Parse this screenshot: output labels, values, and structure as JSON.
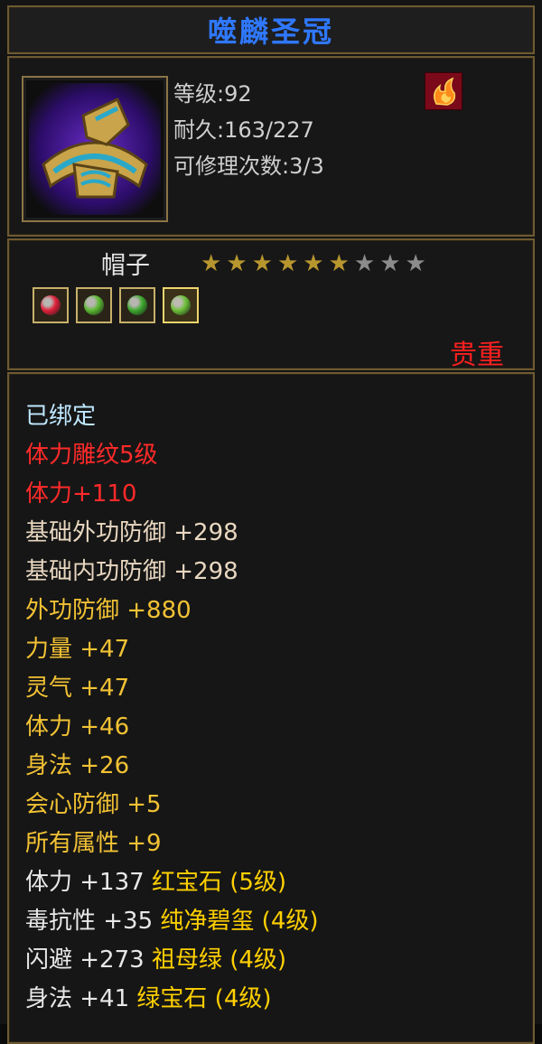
{
  "item": {
    "name": "噬麟圣冠",
    "level_label": "等级",
    "level": "92",
    "durability_label": "耐久",
    "durability": "163/227",
    "repair_label": "可修理次数",
    "repair": "3/3",
    "type": "帽子",
    "stars_filled": 6,
    "stars_total": 9,
    "rarity": "贵重"
  },
  "gems": [
    {
      "icon": "red-gem-icon",
      "color": "#e0203a"
    },
    {
      "icon": "green-gem-icon",
      "color": "#5ab830"
    },
    {
      "icon": "green-gem-icon",
      "color": "#3ea82e"
    },
    {
      "icon": "green-gem-icon",
      "color": "#6cc038"
    }
  ],
  "attributes": [
    {
      "text": "已绑定",
      "style": "bound"
    },
    {
      "text": "体力雕纹5级",
      "style": "red"
    },
    {
      "text": "体力+110",
      "style": "red"
    },
    {
      "text": "基础外功防御 +298",
      "style": "base"
    },
    {
      "text": "基础内功防御 +298",
      "style": "base"
    },
    {
      "text": "外功防御 +880",
      "style": "yellow"
    },
    {
      "text": "力量 +47",
      "style": "yellow"
    },
    {
      "text": "灵气 +47",
      "style": "yellow"
    },
    {
      "text": "体力 +46",
      "style": "yellow"
    },
    {
      "text": "身法 +26",
      "style": "yellow"
    },
    {
      "text": "会心防御 +5",
      "style": "yellow"
    },
    {
      "text": "所有属性 +9",
      "style": "yellow"
    }
  ],
  "gem_attributes": [
    {
      "stat": "体力 +137",
      "gem": "红宝石 (5级)"
    },
    {
      "stat": "毒抗性 +35",
      "gem": "纯净碧玺 (4级)"
    },
    {
      "stat": "闪避 +273",
      "gem": "祖母绿 (4级)"
    },
    {
      "stat": "身法 +41",
      "gem": "绿宝石 (4级)"
    }
  ],
  "colors": {
    "title": "#2f78ff",
    "rarity": "#ff1f1f",
    "star_filled": "#b8962e",
    "star_empty": "#8c8c8c"
  }
}
